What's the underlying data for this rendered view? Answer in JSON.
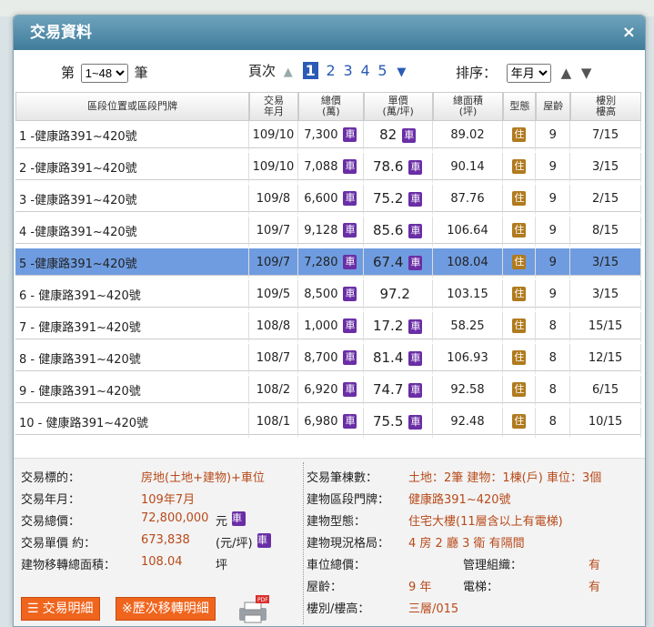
{
  "dialog": {
    "title": "交易資料",
    "close": "×"
  },
  "controls": {
    "page_prefix": "第",
    "page_suffix": "筆",
    "page_range": "1~48",
    "pager_label": "頁次",
    "pages": [
      "1",
      "2",
      "3",
      "4",
      "5"
    ],
    "active_page": "1",
    "sort_label": "排序：",
    "sort_value": "年月"
  },
  "table": {
    "headers": [
      [
        "區段位置或區段門牌"
      ],
      [
        "交易",
        "年月"
      ],
      [
        "總價",
        "(萬)"
      ],
      [
        "單價",
        "(萬/坪)"
      ],
      [
        "總面積",
        "(坪)"
      ],
      [
        "型態"
      ],
      [
        "屋齡"
      ],
      [
        "樓別",
        "樓高"
      ]
    ],
    "car_label": "車",
    "type_label": "住",
    "rows": [
      {
        "addr": "1 -健康路391~420號",
        "ym": "109/10",
        "total": "7,300",
        "unit": "82",
        "area": "89.02",
        "age": "9",
        "floor": "7/15",
        "car_total": true,
        "car_unit": true,
        "sel": false
      },
      {
        "addr": "2 -健康路391~420號",
        "ym": "109/10",
        "total": "7,088",
        "unit": "78.6",
        "area": "90.14",
        "age": "9",
        "floor": "3/15",
        "car_total": true,
        "car_unit": true,
        "sel": false
      },
      {
        "addr": "3 -健康路391~420號",
        "ym": "109/8",
        "total": "6,600",
        "unit": "75.2",
        "area": "87.76",
        "age": "9",
        "floor": "2/15",
        "car_total": true,
        "car_unit": true,
        "sel": false
      },
      {
        "addr": "4 -健康路391~420號",
        "ym": "109/7",
        "total": "9,128",
        "unit": "85.6",
        "area": "106.64",
        "age": "9",
        "floor": "8/15",
        "car_total": true,
        "car_unit": true,
        "sel": false
      },
      {
        "addr": "5 -健康路391~420號",
        "ym": "109/7",
        "total": "7,280",
        "unit": "67.4",
        "area": "108.04",
        "age": "9",
        "floor": "3/15",
        "car_total": true,
        "car_unit": true,
        "sel": true
      },
      {
        "addr": "6 - 健康路391~420號",
        "ym": "109/5",
        "total": "8,500",
        "unit": "97.2",
        "area": "103.15",
        "age": "9",
        "floor": "3/15",
        "car_total": true,
        "car_unit": false,
        "sel": false
      },
      {
        "addr": "7 - 健康路391~420號",
        "ym": "108/8",
        "total": "1,000",
        "unit": "17.2",
        "area": "58.25",
        "age": "8",
        "floor": "15/15",
        "car_total": true,
        "car_unit": true,
        "sel": false
      },
      {
        "addr": "8 - 健康路391~420號",
        "ym": "108/7",
        "total": "8,700",
        "unit": "81.4",
        "area": "106.93",
        "age": "8",
        "floor": "12/15",
        "car_total": true,
        "car_unit": true,
        "sel": false
      },
      {
        "addr": "9 - 健康路391~420號",
        "ym": "108/2",
        "total": "6,920",
        "unit": "74.7",
        "area": "92.58",
        "age": "8",
        "floor": "6/15",
        "car_total": true,
        "car_unit": true,
        "sel": false
      },
      {
        "addr": "10 - 健康路391~420號",
        "ym": "108/1",
        "total": "6,980",
        "unit": "75.5",
        "area": "92.48",
        "age": "8",
        "floor": "10/15",
        "car_total": true,
        "car_unit": true,
        "sel": false
      }
    ]
  },
  "detail": {
    "target_label": "交易標的：",
    "target_value": "房地(土地+建物)+車位",
    "ym_label": "交易年月：",
    "ym_value": "109年7月",
    "total_label": "交易總價：",
    "total_value": "72,800,000",
    "total_unit": "元",
    "unit_label": "交易單價 約：",
    "unit_value": "673,838",
    "unit_unit": "(元/坪)",
    "area_label": "建物移轉總面積：",
    "area_value": "108.04",
    "area_unit": "坪",
    "count_label": "交易筆棟數：",
    "count_value": "土地：2筆 建物：1棟(戶) 車位：3個",
    "addr_label": "建物區段門牌：",
    "addr_value": "健康路391~420號",
    "btype_label": "建物型態：",
    "btype_value": "住宅大樓(11層含以上有電梯)",
    "layout_label": "建物現況格局：",
    "layout_value": "4 房 2 廳 3 衛 有隔間",
    "park_label": "車位總價：",
    "mgmt_label": "管理組織：",
    "mgmt_value": "有",
    "age_label": "屋齡：",
    "age_value": "9 年",
    "elev_label": "電梯：",
    "elev_value": "有",
    "floor_label": "樓別/樓高：",
    "floor_value": "三層/015",
    "btn_detail": "交易明細",
    "btn_history": "※歷次移轉明細"
  }
}
